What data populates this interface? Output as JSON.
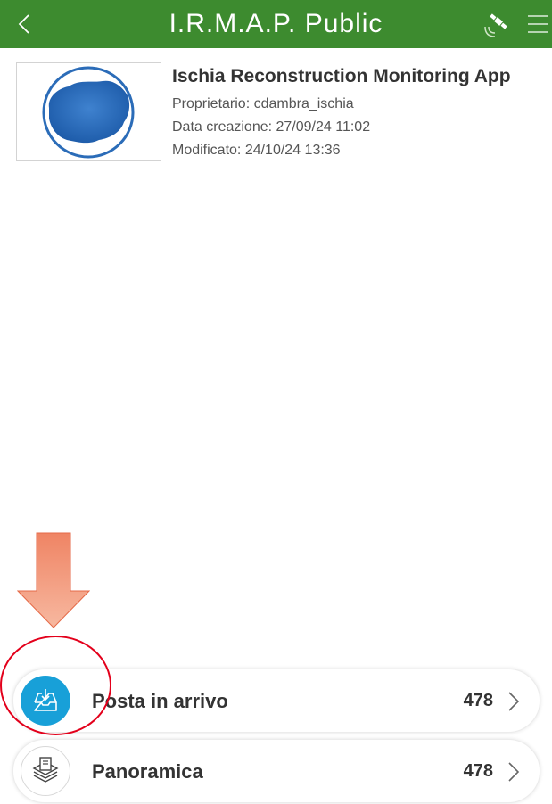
{
  "header": {
    "title": "I.R.M.A.P. Public",
    "color": "#3d8b2f",
    "icons": [
      "chevron-left-icon",
      "satellite-gps-icon",
      "hamburger-menu-icon"
    ]
  },
  "app": {
    "name": "Ischia Reconstruction Monitoring App",
    "owner": "Proprietario: cdambra_ischia",
    "created": "Data creazione: 27/09/24 11:02",
    "modified": "Modificato: 24/10/24 13:36",
    "thumbnail_icon": "ischia-island-logo"
  },
  "list": [
    {
      "label": "Posta in arrivo",
      "count": "478",
      "icon": "inbox-download-icon",
      "icon_color": "#18a0d8"
    },
    {
      "label": "Panoramica",
      "count": "478",
      "icon": "layers-stack-icon"
    }
  ],
  "annotations": {
    "arrow_color": "#f08a68",
    "circle_color": "#e3001b"
  }
}
